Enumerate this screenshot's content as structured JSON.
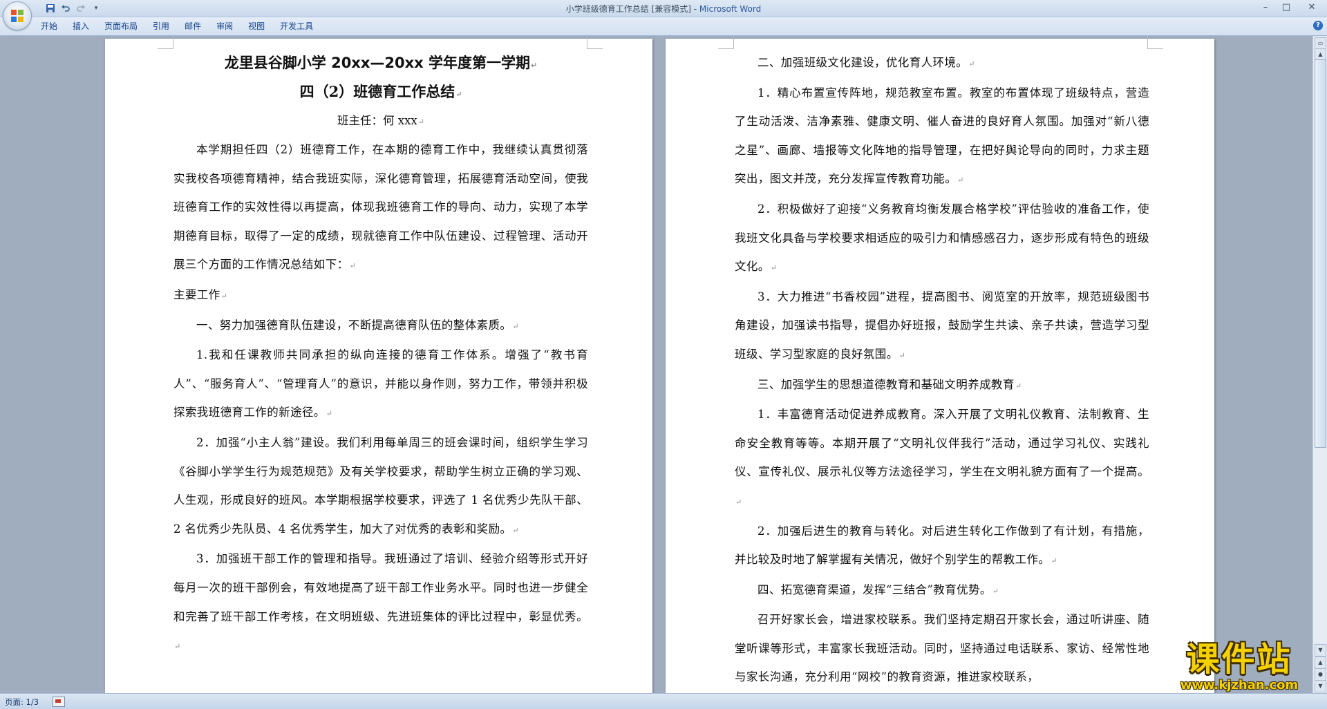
{
  "window": {
    "title": "小学班级德育工作总结 [兼容模式] - ",
    "app_name": "Microsoft Word",
    "controls": [
      "–",
      "□",
      "✕"
    ]
  },
  "ribbon": {
    "tabs": [
      "开始",
      "插入",
      "页面布局",
      "引用",
      "邮件",
      "审阅",
      "视图",
      "开发工具"
    ],
    "help": "?"
  },
  "left_page": {
    "title_line1": "龙里县谷脚小学 20xx—20xx 学年度第一学期",
    "title_line2": "四（2）班德育工作总结",
    "byline": "班主任：何 xxx",
    "paragraphs": [
      "本学期担任四（2）班德育工作，在本期的德育工作中，我继续认真贯彻落实我校各项德育精神，结合我班实际，深化德育管理，拓展德育活动空间，使我班德育工作的实效性得以再提高，体现我班德育工作的导向、动力，实现了本学期德育目标，取得了一定的成绩，现就德育工作中队伍建设、过程管理、活动开展三个方面的工作情况总结如下：",
      "主要工作",
      "一、努力加强德育队伍建设，不断提高德育队伍的整体素质。",
      "1.我和任课教师共同承担的纵向连接的德育工作体系。增强了“教书育人”、“服务育人”、“管理育人”的意识，并能以身作则，努力工作，带领并积极探索我班德育工作的新途径。",
      "2．加强“小主人翁”建设。我们利用每单周三的班会课时间，组织学生学习《谷脚小学学生行为规范规范》及有关学校要求，帮助学生树立正确的学习观、人生观，形成良好的班风。本学期根据学校要求，评选了 1 名优秀少先队干部、2 名优秀少先队员、4 名优秀学生，加大了对优秀的表彰和奖励。",
      "3．加强班干部工作的管理和指导。我班通过了培训、经验介绍等形式开好每月一次的班干部例会，有效地提高了班干部工作业务水平。同时也进一步健全和完善了班干部工作考核，在文明班级、先进班集体的评比过程中，彰显优秀。"
    ]
  },
  "right_page": {
    "paragraphs": [
      "二、加强班级文化建设，优化育人环境。",
      "1．精心布置宣传阵地，规范教室布置。教室的布置体现了班级特点，营造了生动活泼、洁净素雅、健康文明、催人奋进的良好育人氛围。加强对“新八德之星”、画廊、墙报等文化阵地的指导管理，在把好舆论导向的同时，力求主题突出，图文并茂，充分发挥宣传教育功能。",
      "2．积极做好了迎接“义务教育均衡发展合格学校”评估验收的准备工作，使我班文化具备与学校要求相适应的吸引力和情感感召力，逐步形成有特色的班级文化。",
      "3．大力推进“书香校园”进程，提高图书、阅览室的开放率，规范班级图书角建设，加强读书指导，提倡办好班报，鼓励学生共读、亲子共读，营造学习型班级、学习型家庭的良好氛围。",
      "三、加强学生的思想道德教育和基础文明养成教育",
      "1．丰富德育活动促进养成教育。深入开展了文明礼仪教育、法制教育、生命安全教育等等。本期开展了“文明礼仪伴我行”活动，通过学习礼仪、实践礼仪、宣传礼仪、展示礼仪等方法途径学习，学生在文明礼貌方面有了一个提高。",
      "2．加强后进生的教育与转化。对后进生转化工作做到了有计划，有措施，并比较及时地了解掌握有关情况，做好个别学生的帮教工作。",
      "四、拓宽德育渠道，发挥“三结合”教育优势。",
      "召开好家长会，增进家校联系。我们坚持定期召开家长会，通过听讲座、随堂听课等形式，丰富家长我班活动。同时，坚持通过电话联系、家访、经常性地与家长沟通，充分利用“网校”的教育资源，推进家校联系，"
    ]
  },
  "status_bar": {
    "page_info": "页面: 1/3"
  },
  "watermark": {
    "chinese": "课件站",
    "url": "www.kjzhan.com"
  },
  "colors": {
    "title_app": "#2b5797",
    "tab_text": "#15428b",
    "doc_background": "#9fadbf",
    "watermark_fill": "#f6d100"
  }
}
